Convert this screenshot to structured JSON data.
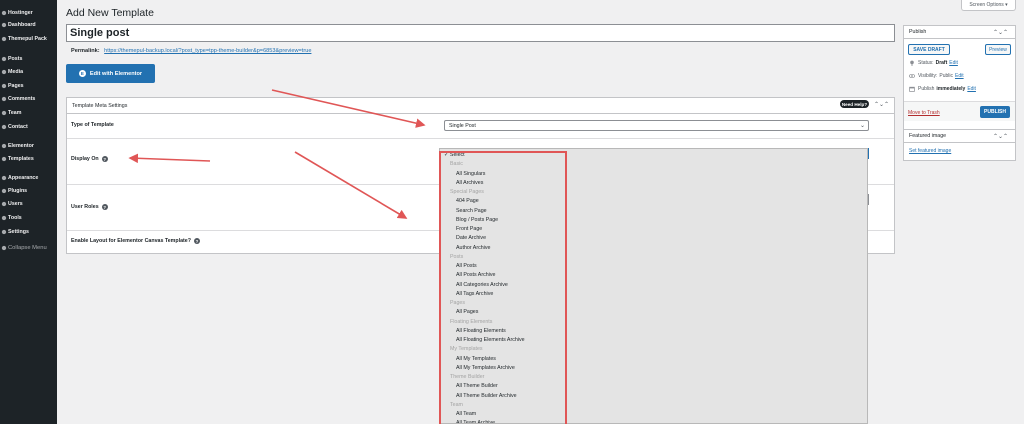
{
  "sidebar": {
    "items": [
      {
        "label": "Hostinger",
        "icon": "hostinger-icon"
      },
      {
        "label": "Dashboard",
        "icon": "dashboard-icon"
      },
      {
        "label": "Themepul Pack",
        "icon": "themepul-icon"
      },
      {
        "label": "Posts",
        "icon": "pin-icon"
      },
      {
        "label": "Media",
        "icon": "media-icon"
      },
      {
        "label": "Pages",
        "icon": "pages-icon"
      },
      {
        "label": "Comments",
        "icon": "comments-icon"
      },
      {
        "label": "Team",
        "icon": "team-icon"
      },
      {
        "label": "Contact",
        "icon": "contact-icon"
      },
      {
        "label": "Elementor",
        "icon": "elementor-icon"
      },
      {
        "label": "Templates",
        "icon": "templates-icon"
      },
      {
        "label": "Appearance",
        "icon": "appearance-icon"
      },
      {
        "label": "Plugins",
        "icon": "plugins-icon"
      },
      {
        "label": "Users",
        "icon": "users-icon"
      },
      {
        "label": "Tools",
        "icon": "tools-icon"
      },
      {
        "label": "Settings",
        "icon": "settings-icon"
      },
      {
        "label": "Collapse Menu",
        "icon": "collapse-icon"
      }
    ]
  },
  "header": {
    "page_title": "Add New Template",
    "screen_options": "Screen Options ▾"
  },
  "editor": {
    "title_value": "Single post",
    "permalink_label": "Permalink:",
    "permalink_url": "https://themepul-backup.local/?post_type=tpp-theme-builder&p=6853&preview=true",
    "elementor_button": "Edit with Elementor"
  },
  "meta_box": {
    "title": "Template Meta Settings",
    "need_help": "Need Help?",
    "collapse_arrows": "⌃⌄⌃",
    "rows": {
      "type_label": "Type of Template",
      "type_value": "Single Post",
      "display_label": "Display On",
      "roles_label": "User Roles",
      "canvas_label": "Enable Layout for Elementor Canvas Template?"
    }
  },
  "dropdown": {
    "selected": "✓ Select",
    "groups": [
      {
        "name": "Basic",
        "items": [
          "All Singulars",
          "All Archives"
        ]
      },
      {
        "name": "Special Pages",
        "items": [
          "404 Page",
          "Search Page",
          "Blog / Posts Page",
          "Front Page",
          "Date Archive",
          "Author Archive"
        ]
      },
      {
        "name": "Posts",
        "items": [
          "All Posts",
          "All Posts Archive",
          "All Categories Archive",
          "All Tags Archive"
        ]
      },
      {
        "name": "Pages",
        "items": [
          "All Pages"
        ]
      },
      {
        "name": "Floating Elements",
        "items": [
          "All Floating Elements",
          "All Floating Elements Archive"
        ]
      },
      {
        "name": "My Templates",
        "items": [
          "All My Templates",
          "All My Templates Archive"
        ]
      },
      {
        "name": "Theme Builder",
        "items": [
          "All Theme Builder",
          "All Theme Builder Archive"
        ]
      },
      {
        "name": "Team",
        "items": [
          "All Team",
          "All Team Archive"
        ]
      }
    ]
  },
  "publish_box": {
    "title": "Publish",
    "arrows": "⌃⌄⌃",
    "save_draft": "SAVE DRAFT",
    "preview": "Preview",
    "status_label": "Status:",
    "status_value": "Draft",
    "visibility_label": "Visibility:",
    "visibility_value": "Public",
    "publish_label": "Publish",
    "publish_value": "immediately",
    "edit": "Edit",
    "trash": "Move to Trash",
    "publish_button": "PUBLISH"
  },
  "featured_box": {
    "title": "Featured image",
    "arrows": "⌃⌄⌃",
    "link": "Set featured image"
  },
  "colors": {
    "sidebar_bg": "#1d2327",
    "accent": "#2271b1",
    "annotation_red": "#e05656"
  }
}
